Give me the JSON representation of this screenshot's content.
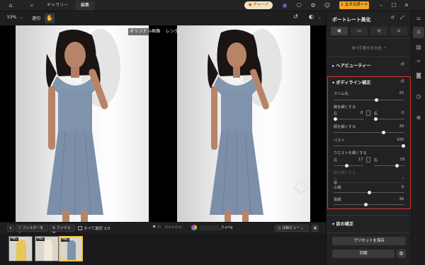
{
  "header": {
    "tabs": [
      "ギャラリー",
      "編集"
    ],
    "charge_label": "チャージ",
    "export_label": "エクスポート"
  },
  "viewbar": {
    "zoom": "53%",
    "fit_label": "適切"
  },
  "canvas": {
    "original_label": "オリジナル画像",
    "render_label": "レンダリング"
  },
  "filmbar": {
    "filter_label": "フィルターをし",
    "filename_label": "ファイル名",
    "select_all_label": "すべて選択 1/3",
    "file_name": "_5.png",
    "compare_label": "比較ビュー"
  },
  "thumbs": [
    {
      "badge": "PNG"
    },
    {
      "badge": "PNG"
    },
    {
      "badge": "PNG"
    }
  ],
  "panel": {
    "title": "ポートレート美化",
    "collapse_all": "すべて折りたたむ",
    "hair_section": "ヘアビューティー",
    "body_section": "ボディライン補正",
    "sliders": {
      "slim": {
        "label": "スリム化",
        "value": "25",
        "pos": 0.6
      },
      "arm_header": "腕を細くする",
      "arm_left": {
        "label": "左",
        "value": "0",
        "pos": 0.0
      },
      "arm_right": {
        "label": "右",
        "value": "0",
        "pos": 0.0
      },
      "neck": {
        "label": "頭を細くする",
        "value": "39",
        "pos": 0.7
      },
      "bust": {
        "label": "バスト",
        "value": "100",
        "pos": 1.0
      },
      "waist_header": "ウエストを細くする",
      "waist_left": {
        "label": "左",
        "value": "17",
        "pos": 0.4
      },
      "waist_right": {
        "label": "右",
        "value": "55",
        "pos": 0.75
      },
      "leg_header": "脚を細くする",
      "leg_left": {
        "label": "左",
        "value": "0",
        "pos": 0.0
      },
      "head": {
        "label": "小顔",
        "value": "0",
        "pos": 0.5
      },
      "height": {
        "label": "長脚",
        "value": "36",
        "pos": 0.45
      }
    },
    "eye_section": "目の補正",
    "save_preset": "プリセットを保存",
    "sync_label": "同期"
  },
  "colors": {
    "accent_orange": "#f5a623",
    "highlight_red": "#d9352a",
    "dress_blue": "#7f93ad"
  }
}
